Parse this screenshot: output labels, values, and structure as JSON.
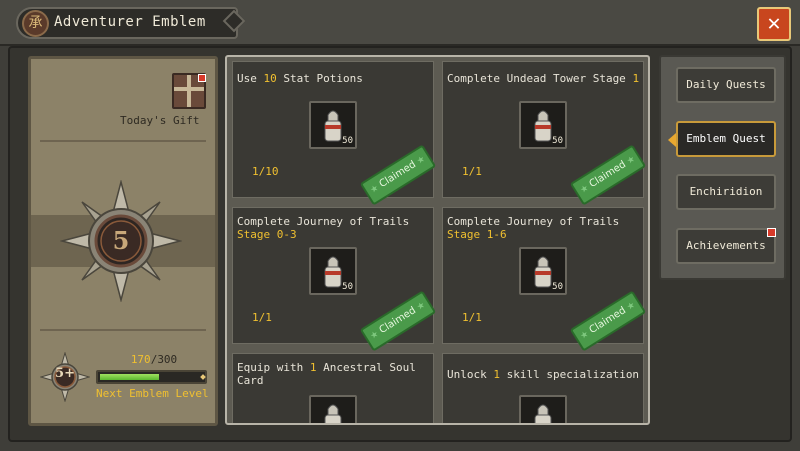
{
  "header": {
    "title": "Adventurer Emblem",
    "emblem_glyph": "承",
    "close_glyph": "✕"
  },
  "left_panel": {
    "gift_label": "Today's Gift",
    "emblem_level": "5",
    "xp_current": "170",
    "xp_separator": "/",
    "xp_max": "300",
    "xp_fraction": 0.57,
    "next_level_label": "Next Emblem Level"
  },
  "quests": [
    {
      "title_parts": [
        "Use ",
        "10",
        " Stat Potions"
      ],
      "subtitle": "",
      "item_count": "50",
      "progress": "1/10",
      "status": "Claimed"
    },
    {
      "title_parts": [
        "Complete Undead Tower Stage ",
        "1",
        ""
      ],
      "subtitle": "",
      "item_count": "50",
      "progress": "1/1",
      "status": "Claimed"
    },
    {
      "title_parts": [
        "Complete Journey of Trails",
        "",
        ""
      ],
      "subtitle": "Stage 0-3",
      "item_count": "50",
      "progress": "1/1",
      "status": "Claimed"
    },
    {
      "title_parts": [
        "Complete Journey of Trails",
        "",
        ""
      ],
      "subtitle": "Stage 1-6",
      "item_count": "50",
      "progress": "1/1",
      "status": "Claimed"
    },
    {
      "title_parts": [
        "Equip with ",
        "1",
        " Ancestral Soul Card"
      ],
      "subtitle": "",
      "item_count": "",
      "progress": "",
      "status": ""
    },
    {
      "title_parts": [
        "Unlock ",
        "1",
        " skill specialization"
      ],
      "subtitle": "",
      "item_count": "",
      "progress": "",
      "status": ""
    }
  ],
  "tabs": [
    {
      "label": "Daily Quests",
      "active": false
    },
    {
      "label": "Emblem Quest",
      "active": true
    },
    {
      "label": "Enchiridion",
      "active": false
    },
    {
      "label": "Achievements",
      "active": false
    }
  ],
  "colors": {
    "highlight": "#f0c030",
    "claimed_green": "#4a9a4a",
    "close_red": "#c8461e",
    "notification_red": "#d83a2a"
  }
}
